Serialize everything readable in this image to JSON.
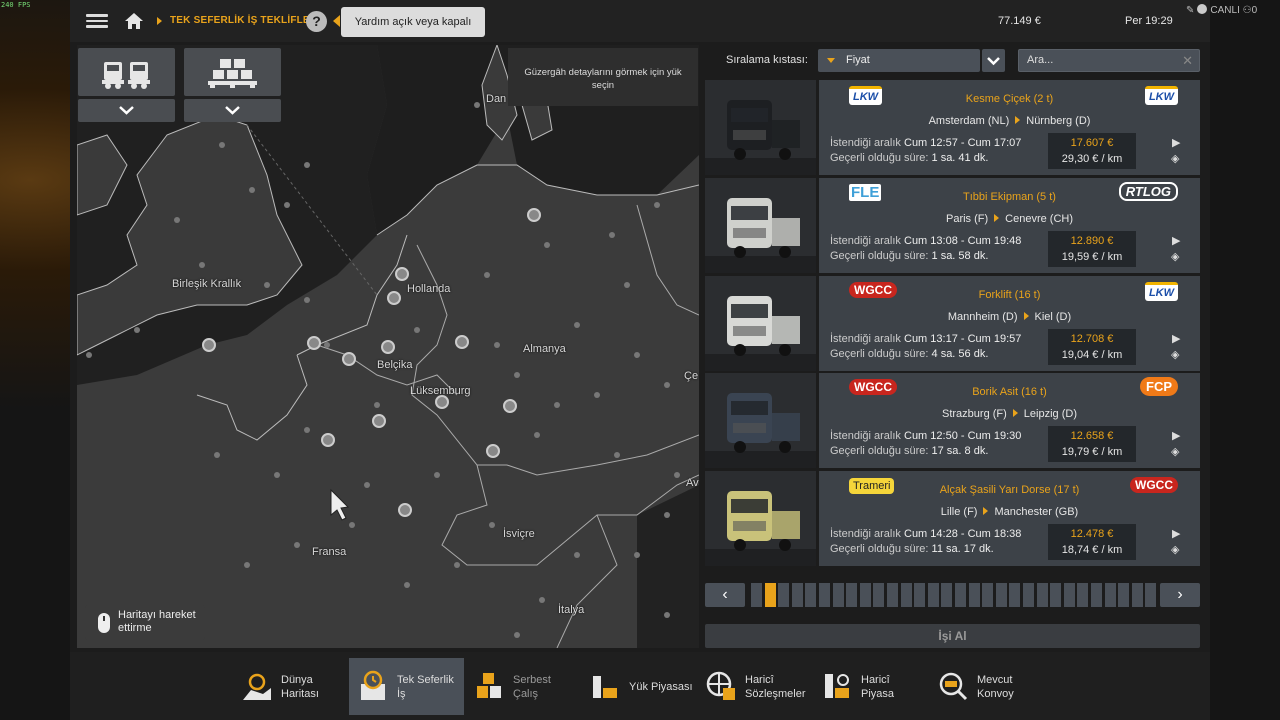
{
  "fps": "240 FPS",
  "topbar": {
    "breadcrumb": "TEK SEFERLİK İŞ TEKLİFLERİ",
    "help_label": "?",
    "help_tooltip": "Yardım açık veya kapalı",
    "money": "77.149 €",
    "clock": "Per 19:29",
    "live_label": "CANLI",
    "viewers": "0"
  },
  "map": {
    "route_tip": "Güzergâh detaylarını görmek için yük seçin",
    "move_tip": "Haritayı hareket ettirme",
    "labels": [
      {
        "name": "Birleşik Krallık"
      },
      {
        "name": "Hollanda"
      },
      {
        "name": "Belçika"
      },
      {
        "name": "Lüksemburg"
      },
      {
        "name": "Almanya"
      },
      {
        "name": "Fransa"
      },
      {
        "name": "İsviçre"
      },
      {
        "name": "İtalya"
      },
      {
        "name": "Dan"
      },
      {
        "name": "Çe"
      },
      {
        "name": "Av"
      }
    ]
  },
  "sort": {
    "label": "Sıralama kıstası:",
    "selected": "Fiyat",
    "search_placeholder": "Ara..."
  },
  "jobs": [
    {
      "cargo": "Kesme Çiçek (2 t)",
      "from": "Amsterdam (NL)",
      "to": "Nürnberg (D)",
      "time_label": "İstendiği aralık",
      "time": "Cum 12:57 - Cum 17:07",
      "valid_label": "Geçerli olduğu süre:",
      "valid": "1 sa. 41 dk.",
      "price": "17.607 €",
      "perkm": "29,30 € / km",
      "src_logo": "LKW",
      "dst_logo": "LKW",
      "truck_color": "#1d1f22"
    },
    {
      "cargo": "Tıbbi Ekipman (5 t)",
      "from": "Paris (F)",
      "to": "Cenevre (CH)",
      "time_label": "İstendiği aralık",
      "time": "Cum 13:08 - Cum 19:48",
      "valid_label": "Geçerli olduğu süre:",
      "valid": "1 sa. 58 dk.",
      "price": "12.890 €",
      "perkm": "19,59 € / km",
      "src_logo": "FLE",
      "dst_logo": "RTLOG",
      "truck_color": "#cfd0cc"
    },
    {
      "cargo": "Forklift (16 t)",
      "from": "Mannheim (D)",
      "to": "Kiel (D)",
      "time_label": "İstendiği aralık",
      "time": "Cum 13:17 - Cum 19:57",
      "valid_label": "Geçerli olduğu süre:",
      "valid": "4 sa. 56 dk.",
      "price": "12.708 €",
      "perkm": "19,04 € / km",
      "src_logo": "WGCC",
      "dst_logo": "LKW",
      "truck_color": "#d8d9d6"
    },
    {
      "cargo": "Borik Asit (16 t)",
      "from": "Strazburg (F)",
      "to": "Leipzig (D)",
      "time_label": "İstendiği aralık",
      "time": "Cum 12:50 - Cum 19:30",
      "valid_label": "Geçerli olduğu süre:",
      "valid": "17 sa. 8 dk.",
      "price": "12.658 €",
      "perkm": "19,79 € / km",
      "src_logo": "WGCC",
      "dst_logo": "FCP",
      "truck_color": "#3a4452"
    },
    {
      "cargo": "Alçak Şasili Yarı Dorse (17 t)",
      "from": "Lille (F)",
      "to": "Manchester (GB)",
      "time_label": "İstendiği aralık",
      "time": "Cum 14:28 - Cum 18:38",
      "valid_label": "Geçerli olduğu süre:",
      "valid": "11 sa. 17 dk.",
      "price": "12.478 €",
      "perkm": "18,74 € / km",
      "src_logo": "Trameri",
      "dst_logo": "WGCC",
      "truck_color": "#c9c27a"
    }
  ],
  "pager": {
    "prev": "‹",
    "next": "›",
    "pages": 30,
    "current": 2
  },
  "take_job": "İşi Al",
  "nav": [
    {
      "label": "Dünya\nHaritası",
      "active": false,
      "dim": false
    },
    {
      "label": "Tek Seferlik\nİş",
      "active": true,
      "dim": false
    },
    {
      "label": "Serbest\nÇalış",
      "active": false,
      "dim": true
    },
    {
      "label": "Yük Piyasası",
      "active": false,
      "dim": false
    },
    {
      "label": "Haricî\nSözleşmeler",
      "active": false,
      "dim": false
    },
    {
      "label": "Haricî\nPiyasa",
      "active": false,
      "dim": false
    },
    {
      "label": "Mevcut\nKonvoy",
      "active": false,
      "dim": false
    }
  ],
  "colors": {
    "accent": "#e9a31b",
    "panel": "#3d4248",
    "button": "#4a5058"
  }
}
